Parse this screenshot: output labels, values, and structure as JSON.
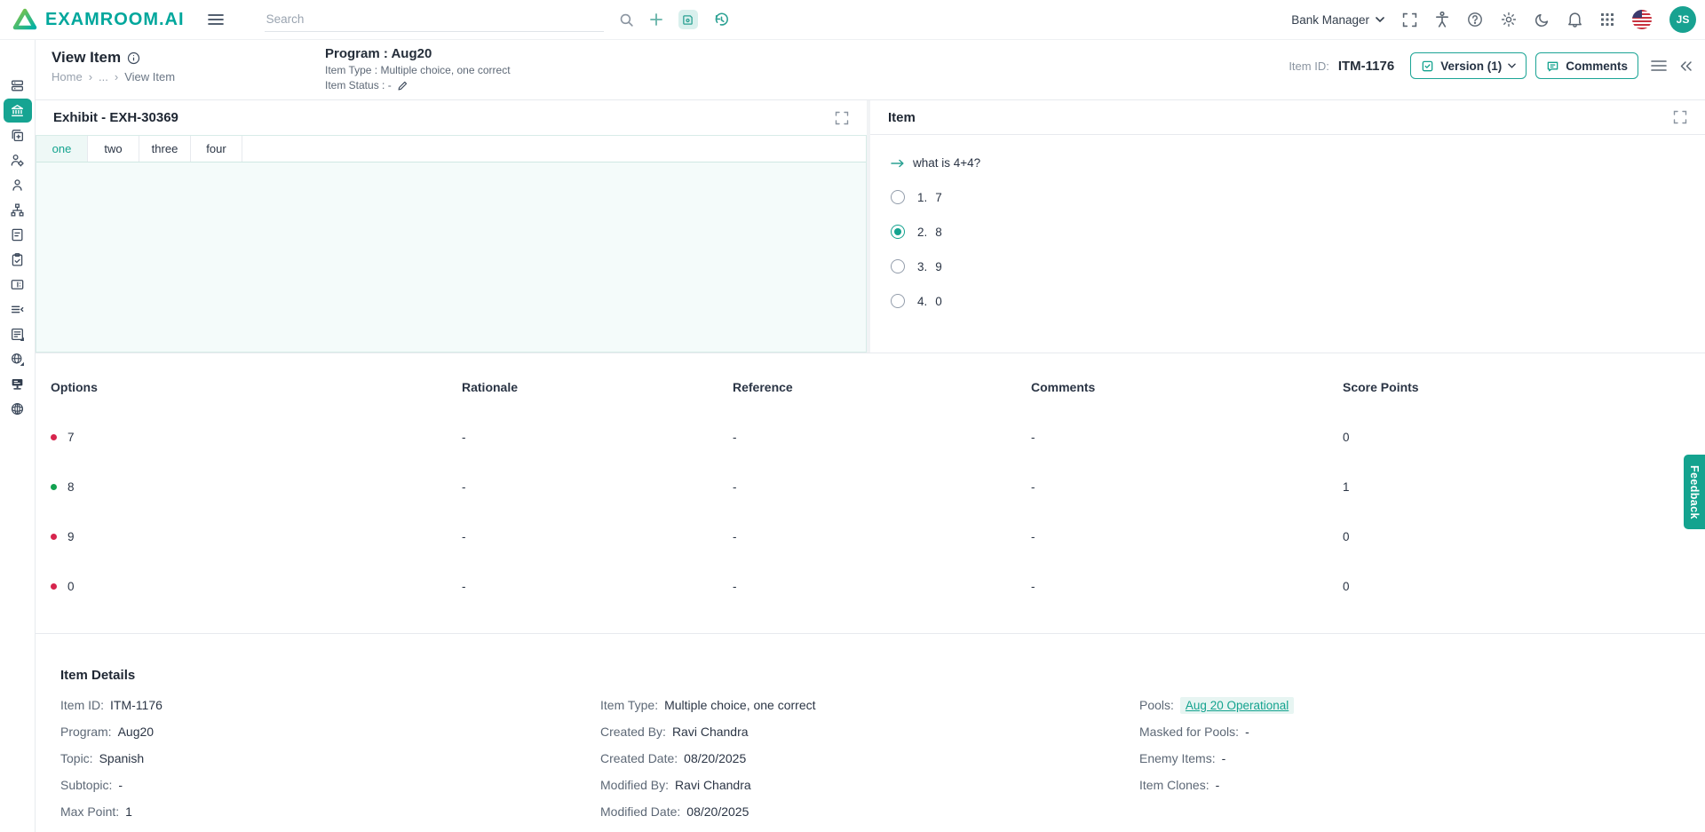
{
  "topnav": {
    "logo_text": "EXAMROOM.AI",
    "search_placeholder": "Search",
    "role": "Bank Manager",
    "avatar_initials": "JS"
  },
  "header": {
    "title": "View Item",
    "breadcrumb": [
      "Home",
      "...",
      "View Item"
    ],
    "crumb_sep": "›",
    "program_title": "Program : Aug20",
    "item_type_line": "Item Type : Multiple choice, one correct",
    "item_status_line": "Item Status : -",
    "item_id_label": "Item ID:",
    "item_id_value": "ITM-1176",
    "version_label": "Version (1)",
    "comments_label": "Comments"
  },
  "exhibit": {
    "title": "Exhibit - EXH-30369",
    "tabs": [
      {
        "label": "one",
        "state": "active"
      },
      {
        "label": "two",
        "state": ""
      },
      {
        "label": "three",
        "state": ""
      },
      {
        "label": "four",
        "state": ""
      }
    ]
  },
  "item": {
    "title": "Item",
    "question": "what is 4+4?",
    "options": [
      {
        "num": "1.",
        "text": "7",
        "state": ""
      },
      {
        "num": "2.",
        "text": "8",
        "state": "selected"
      },
      {
        "num": "3.",
        "text": "9",
        "state": ""
      },
      {
        "num": "4.",
        "text": "0",
        "state": ""
      }
    ]
  },
  "options_table": {
    "headers": [
      "Options",
      "Rationale",
      "Reference",
      "Comments",
      "Score Points"
    ],
    "rows": [
      {
        "dot": "red",
        "option": "7",
        "rationale": "-",
        "reference": "-",
        "comments": "-",
        "score": "0"
      },
      {
        "dot": "green",
        "option": "8",
        "rationale": "-",
        "reference": "-",
        "comments": "-",
        "score": "1"
      },
      {
        "dot": "red",
        "option": "9",
        "rationale": "-",
        "reference": "-",
        "comments": "-",
        "score": "0"
      },
      {
        "dot": "red",
        "option": "0",
        "rationale": "-",
        "reference": "-",
        "comments": "-",
        "score": "0"
      }
    ]
  },
  "details": {
    "title": "Item Details",
    "col1": [
      {
        "label": "Item ID:",
        "value": "ITM-1176"
      },
      {
        "label": "Program:",
        "value": "Aug20"
      },
      {
        "label": "Topic:",
        "value": "Spanish"
      },
      {
        "label": "Subtopic:",
        "value": "-"
      },
      {
        "label": "Max Point:",
        "value": "1"
      }
    ],
    "col2": [
      {
        "label": "Item Type:",
        "value": "Multiple choice, one correct"
      },
      {
        "label": "Created By:",
        "value": "Ravi Chandra"
      },
      {
        "label": "Created Date:",
        "value": "08/20/2025"
      },
      {
        "label": "Modified By:",
        "value": "Ravi Chandra"
      },
      {
        "label": "Modified Date:",
        "value": "08/20/2025"
      }
    ],
    "col3": {
      "pools_label": "Pools:",
      "pools_value": "Aug 20 Operational",
      "rest": [
        {
          "label": "Masked for Pools:",
          "value": "-"
        },
        {
          "label": "Enemy Items:",
          "value": "-"
        },
        {
          "label": "Item Clones:",
          "value": "-"
        }
      ]
    }
  },
  "feedback_label": "Feedback",
  "colors": {
    "accent": "#14a38f",
    "incorrect_dot": "#d6254d",
    "correct_dot": "#12a150",
    "exhibit_bg": "#f4fbfa"
  }
}
